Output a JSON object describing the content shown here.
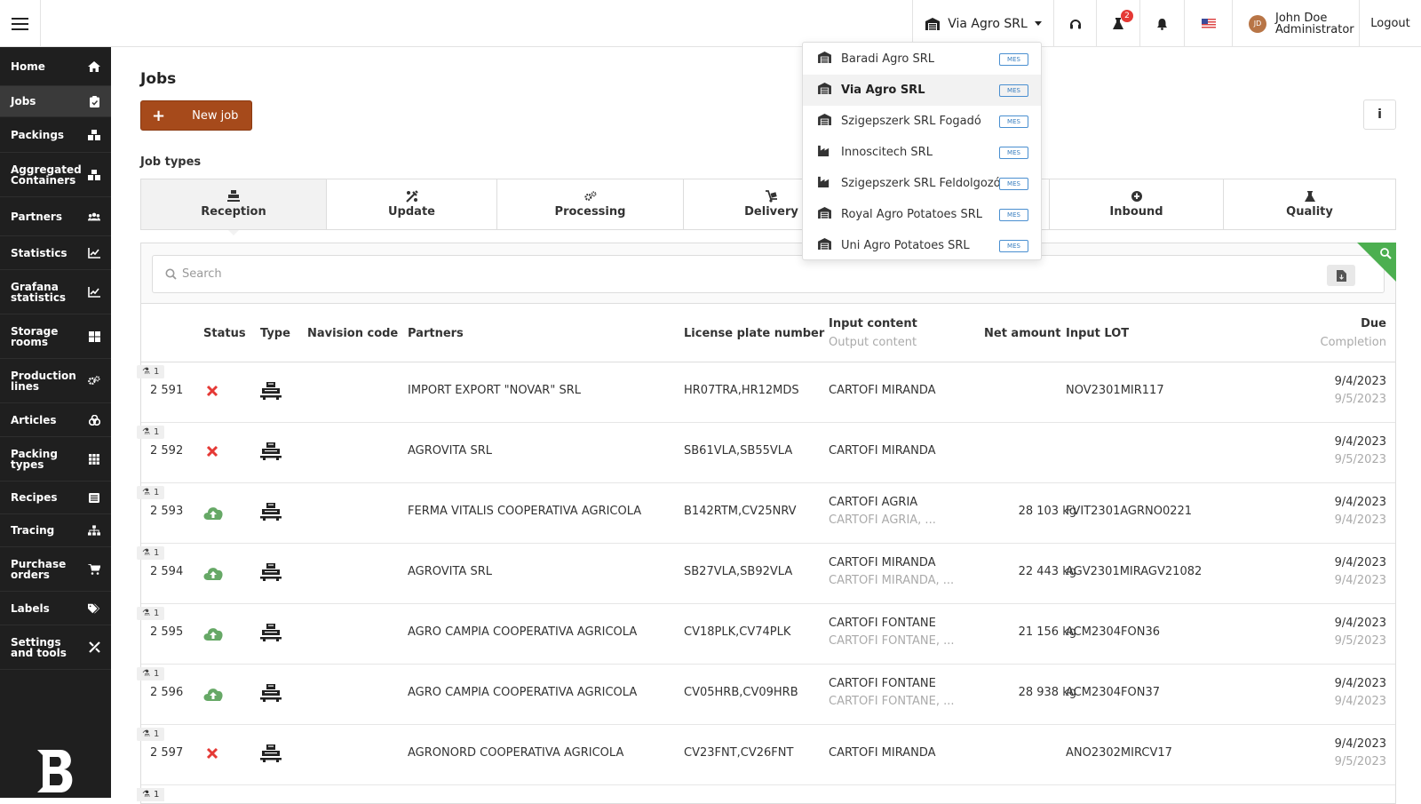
{
  "topbar": {
    "company": "Via Agro SRL",
    "notification_count": "2",
    "user_initials": "JD",
    "user_name": "John Doe",
    "user_role": "Administrator",
    "logout_label": "Logout"
  },
  "sidebar": {
    "items": [
      {
        "label": "Home",
        "icon": "home-icon"
      },
      {
        "label": "Jobs",
        "icon": "clipboard-icon"
      },
      {
        "label": "Packings",
        "icon": "boxes-icon"
      },
      {
        "label": "Aggregated Containers",
        "icon": "boxes-icon"
      },
      {
        "label": "Partners",
        "icon": "users-icon"
      },
      {
        "label": "Statistics",
        "icon": "chart-line-icon"
      },
      {
        "label": "Grafana statistics",
        "icon": "chart-line-icon"
      },
      {
        "label": "Storage rooms",
        "icon": "grid-icon"
      },
      {
        "label": "Production lines",
        "icon": "cogs-icon"
      },
      {
        "label": "Articles",
        "icon": "articles-icon"
      },
      {
        "label": "Packing types",
        "icon": "grid-icon"
      },
      {
        "label": "Recipes",
        "icon": "list-icon"
      },
      {
        "label": "Tracing",
        "icon": "sitemap-icon"
      },
      {
        "label": "Purchase orders",
        "icon": "cart-icon"
      },
      {
        "label": "Labels",
        "icon": "tags-icon"
      },
      {
        "label": "Settings and tools",
        "icon": "tools-icon"
      }
    ]
  },
  "main": {
    "title": "Jobs",
    "new_job_label": "New job",
    "job_types_label": "Job types",
    "tabs": [
      {
        "label": "Reception",
        "icon": "reception-icon"
      },
      {
        "label": "Update",
        "icon": "update-icon"
      },
      {
        "label": "Processing",
        "icon": "cogs-icon"
      },
      {
        "label": "Delivery",
        "icon": "delivery-icon"
      },
      {
        "label": "Inbound",
        "icon": "inbound-icon"
      },
      {
        "label": "Quality",
        "icon": "flask-icon"
      }
    ],
    "search_placeholder": "Search"
  },
  "table": {
    "headers": {
      "status": "Status",
      "type": "Type",
      "navision": "Navision code",
      "partners": "Partners",
      "license": "License plate number",
      "input_content": "Input content",
      "output_content": "Output content",
      "net_amount": "Net amount",
      "input_lot": "Input LOT",
      "due": "Due",
      "completion": "Completion"
    },
    "rows": [
      {
        "tag": "1",
        "id": "2 591",
        "status": "failed",
        "partner": "IMPORT EXPORT \"NOVAR\" SRL",
        "plate": "HR07TRA,HR12MDS",
        "input": "CARTOFI MIRANDA",
        "output": "",
        "net": "",
        "lot": "NOV2301MIR117",
        "due": "9/4/2023",
        "completion": "9/5/2023"
      },
      {
        "tag": "1",
        "id": "2 592",
        "status": "failed",
        "partner": "AGROVITA SRL",
        "plate": "SB61VLA,SB55VLA",
        "input": "CARTOFI MIRANDA",
        "output": "",
        "net": "",
        "lot": "",
        "due": "9/4/2023",
        "completion": "9/5/2023"
      },
      {
        "tag": "1",
        "id": "2 593",
        "status": "uploaded",
        "partner": "FERMA VITALIS COOPERATIVA AGRICOLA",
        "plate": "B142RTM,CV25NRV",
        "input": "CARTOFI AGRIA",
        "output": "CARTOFI AGRIA, ...",
        "net": "28 103 kg",
        "lot": "FVIT2301AGRNO0221",
        "due": "9/4/2023",
        "completion": "9/4/2023"
      },
      {
        "tag": "1",
        "id": "2 594",
        "status": "uploaded",
        "partner": "AGROVITA SRL",
        "plate": "SB27VLA,SB92VLA",
        "input": "CARTOFI MIRANDA",
        "output": "CARTOFI MIRANDA, ...",
        "net": "22 443 kg",
        "lot": "AGV2301MIRAGV21082",
        "due": "9/4/2023",
        "completion": "9/4/2023"
      },
      {
        "tag": "1",
        "id": "2 595",
        "status": "uploaded",
        "partner": "AGRO CAMPIA COOPERATIVA AGRICOLA",
        "plate": "CV18PLK,CV74PLK",
        "input": "CARTOFI FONTANE",
        "output": "CARTOFI FONTANE, ...",
        "net": "21 156 kg",
        "lot": "ACM2304FON36",
        "due": "9/4/2023",
        "completion": "9/5/2023"
      },
      {
        "tag": "1",
        "id": "2 596",
        "status": "uploaded",
        "partner": "AGRO CAMPIA COOPERATIVA AGRICOLA",
        "plate": "CV05HRB,CV09HRB",
        "input": "CARTOFI FONTANE",
        "output": "CARTOFI FONTANE, ...",
        "net": "28 938 kg",
        "lot": "ACM2304FON37",
        "due": "9/4/2023",
        "completion": "9/4/2023"
      },
      {
        "tag": "1",
        "id": "2 597",
        "status": "failed",
        "partner": "AGRONORD COOPERATIVA AGRICOLA",
        "plate": "CV23FNT,CV26FNT",
        "input": "CARTOFI MIRANDA",
        "output": "",
        "net": "",
        "lot": "ANO2302MIRCV17",
        "due": "9/4/2023",
        "completion": "9/5/2023"
      }
    ],
    "next_tag": "1"
  },
  "dropdown": {
    "items": [
      {
        "label": "Baradi Agro SRL",
        "badge": "MES",
        "icon": "warehouse-icon"
      },
      {
        "label": "Via Agro SRL",
        "badge": "MES",
        "icon": "warehouse-icon"
      },
      {
        "label": "Szigepszerk SRL Fogadó",
        "badge": "MES",
        "icon": "warehouse-icon"
      },
      {
        "label": "Innoscitech SRL",
        "badge": "MES",
        "icon": "industry-icon"
      },
      {
        "label": "Szigepszerk SRL Feldolgozó",
        "badge": "MES",
        "icon": "industry-icon"
      },
      {
        "label": "Royal Agro Potatoes SRL",
        "badge": "MES",
        "icon": "warehouse-icon"
      },
      {
        "label": "Uni Agro Potatoes SRL",
        "badge": "MES",
        "icon": "warehouse-icon"
      }
    ]
  },
  "colors": {
    "accent": "#a64a1b",
    "success": "#4caf50",
    "error": "#e53935",
    "sidebar": "#1f1f1f"
  }
}
